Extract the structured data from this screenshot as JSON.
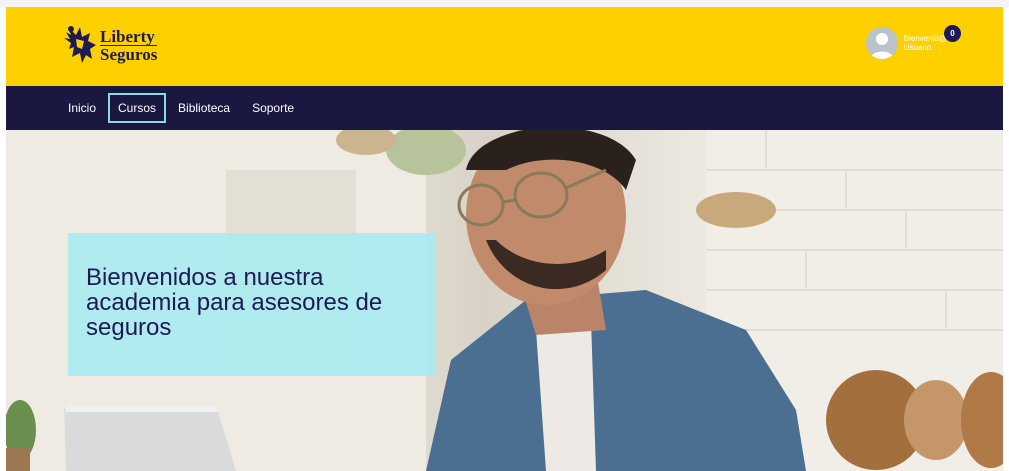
{
  "brand": {
    "logo_line1": "Liberty",
    "logo_line2": "Seguros",
    "header_color": "#ffd000",
    "nav_color": "#1a1740",
    "accent_color": "#8fd8e5"
  },
  "user": {
    "greeting": "Bienvenid@",
    "name": "Usuario",
    "notification_count": "0",
    "icon": "avatar-icon"
  },
  "nav": {
    "items": [
      {
        "label": "Inicio",
        "active": false
      },
      {
        "label": "Cursos",
        "active": true
      },
      {
        "label": "Biblioteca",
        "active": false
      },
      {
        "label": "Soporte",
        "active": false
      }
    ]
  },
  "hero": {
    "headline": "Bienvenidos a nuestra academia para asesores de seguros"
  }
}
